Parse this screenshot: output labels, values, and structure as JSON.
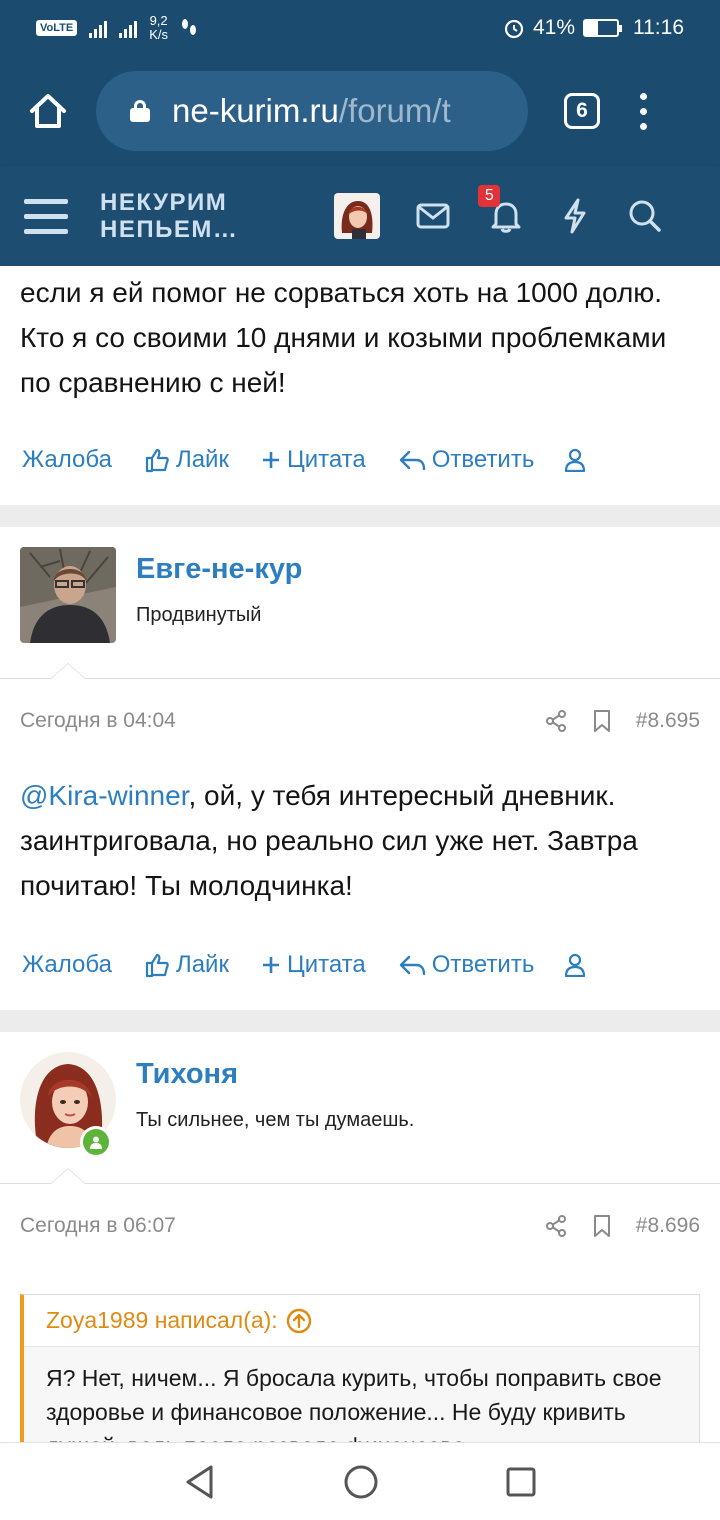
{
  "status_bar": {
    "network": "VoLTE",
    "speed_value": "9,2",
    "speed_unit": "K/s",
    "battery": "41%",
    "battery_level": 0.41,
    "time": "11:16"
  },
  "browser": {
    "url_host": "ne-kurim.ru",
    "url_path": "/forum/t",
    "tab_count": "6"
  },
  "site": {
    "logo_line1": "НЕКУРИМ",
    "logo_line2": "НЕПЬЕМ…",
    "notifications_count": "5"
  },
  "posts": [
    {
      "text": "если я ей помог не сорваться хоть на 1000 долю. Кто я со своими 10 днями и козыми проблемками по сравнению с ней!"
    },
    {
      "author": "Евге-не-кур",
      "author_title": "Продвинутый",
      "time": "Сегодня в 04:04",
      "number": "#8.695",
      "mention": "@Kira-winner",
      "text": ", ой, у тебя интересный дневник. заинтриговала, но реально сил уже нет. Завтра почитаю! Ты молодчинка!"
    },
    {
      "author": "Тихоня",
      "author_title": "Ты сильнее, чем ты думаешь.",
      "time": "Сегодня в 06:07",
      "number": "#8.696",
      "quote_author": "Zoya1989 написал(а):",
      "quote_text": "Я? Нет, ничем... Я бросала курить, чтобы поправить свое здоровье и финансовое положение... Не буду кривить душой, ведь после развода финансово"
    }
  ],
  "actions": {
    "report": "Жалоба",
    "like": "Лайк",
    "quote": "Цитата",
    "reply": "Ответить"
  },
  "icons": {
    "home": "home-icon",
    "lock": "lock-icon",
    "menu": "more-vert-icon",
    "mail": "mail-icon",
    "bell": "bell-icon",
    "bolt": "bolt-icon",
    "search": "search-icon",
    "share": "share-icon",
    "bookmark": "bookmark-icon",
    "user": "user-icon"
  },
  "colors": {
    "header": "#1e4d72",
    "browser": "#1b4b6e",
    "link": "#2d7ec0",
    "quote_accent": "#f19a1d",
    "online": "#5db43a",
    "badge": "#e2333b"
  }
}
